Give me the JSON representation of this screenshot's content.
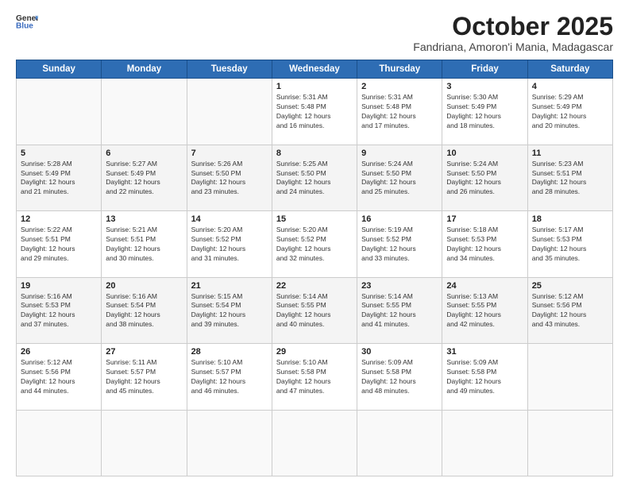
{
  "logo": {
    "general": "General",
    "blue": "Blue"
  },
  "header": {
    "month": "October 2025",
    "location": "Fandriana, Amoron'i Mania, Madagascar"
  },
  "weekdays": [
    "Sunday",
    "Monday",
    "Tuesday",
    "Wednesday",
    "Thursday",
    "Friday",
    "Saturday"
  ],
  "days": [
    {
      "date": "",
      "info": ""
    },
    {
      "date": "",
      "info": ""
    },
    {
      "date": "",
      "info": ""
    },
    {
      "date": "1",
      "info": "Sunrise: 5:31 AM\nSunset: 5:48 PM\nDaylight: 12 hours\nand 16 minutes."
    },
    {
      "date": "2",
      "info": "Sunrise: 5:31 AM\nSunset: 5:48 PM\nDaylight: 12 hours\nand 17 minutes."
    },
    {
      "date": "3",
      "info": "Sunrise: 5:30 AM\nSunset: 5:49 PM\nDaylight: 12 hours\nand 18 minutes."
    },
    {
      "date": "4",
      "info": "Sunrise: 5:29 AM\nSunset: 5:49 PM\nDaylight: 12 hours\nand 20 minutes."
    },
    {
      "date": "5",
      "info": "Sunrise: 5:28 AM\nSunset: 5:49 PM\nDaylight: 12 hours\nand 21 minutes."
    },
    {
      "date": "6",
      "info": "Sunrise: 5:27 AM\nSunset: 5:49 PM\nDaylight: 12 hours\nand 22 minutes."
    },
    {
      "date": "7",
      "info": "Sunrise: 5:26 AM\nSunset: 5:50 PM\nDaylight: 12 hours\nand 23 minutes."
    },
    {
      "date": "8",
      "info": "Sunrise: 5:25 AM\nSunset: 5:50 PM\nDaylight: 12 hours\nand 24 minutes."
    },
    {
      "date": "9",
      "info": "Sunrise: 5:24 AM\nSunset: 5:50 PM\nDaylight: 12 hours\nand 25 minutes."
    },
    {
      "date": "10",
      "info": "Sunrise: 5:24 AM\nSunset: 5:50 PM\nDaylight: 12 hours\nand 26 minutes."
    },
    {
      "date": "11",
      "info": "Sunrise: 5:23 AM\nSunset: 5:51 PM\nDaylight: 12 hours\nand 28 minutes."
    },
    {
      "date": "12",
      "info": "Sunrise: 5:22 AM\nSunset: 5:51 PM\nDaylight: 12 hours\nand 29 minutes."
    },
    {
      "date": "13",
      "info": "Sunrise: 5:21 AM\nSunset: 5:51 PM\nDaylight: 12 hours\nand 30 minutes."
    },
    {
      "date": "14",
      "info": "Sunrise: 5:20 AM\nSunset: 5:52 PM\nDaylight: 12 hours\nand 31 minutes."
    },
    {
      "date": "15",
      "info": "Sunrise: 5:20 AM\nSunset: 5:52 PM\nDaylight: 12 hours\nand 32 minutes."
    },
    {
      "date": "16",
      "info": "Sunrise: 5:19 AM\nSunset: 5:52 PM\nDaylight: 12 hours\nand 33 minutes."
    },
    {
      "date": "17",
      "info": "Sunrise: 5:18 AM\nSunset: 5:53 PM\nDaylight: 12 hours\nand 34 minutes."
    },
    {
      "date": "18",
      "info": "Sunrise: 5:17 AM\nSunset: 5:53 PM\nDaylight: 12 hours\nand 35 minutes."
    },
    {
      "date": "19",
      "info": "Sunrise: 5:16 AM\nSunset: 5:53 PM\nDaylight: 12 hours\nand 37 minutes."
    },
    {
      "date": "20",
      "info": "Sunrise: 5:16 AM\nSunset: 5:54 PM\nDaylight: 12 hours\nand 38 minutes."
    },
    {
      "date": "21",
      "info": "Sunrise: 5:15 AM\nSunset: 5:54 PM\nDaylight: 12 hours\nand 39 minutes."
    },
    {
      "date": "22",
      "info": "Sunrise: 5:14 AM\nSunset: 5:55 PM\nDaylight: 12 hours\nand 40 minutes."
    },
    {
      "date": "23",
      "info": "Sunrise: 5:14 AM\nSunset: 5:55 PM\nDaylight: 12 hours\nand 41 minutes."
    },
    {
      "date": "24",
      "info": "Sunrise: 5:13 AM\nSunset: 5:55 PM\nDaylight: 12 hours\nand 42 minutes."
    },
    {
      "date": "25",
      "info": "Sunrise: 5:12 AM\nSunset: 5:56 PM\nDaylight: 12 hours\nand 43 minutes."
    },
    {
      "date": "26",
      "info": "Sunrise: 5:12 AM\nSunset: 5:56 PM\nDaylight: 12 hours\nand 44 minutes."
    },
    {
      "date": "27",
      "info": "Sunrise: 5:11 AM\nSunset: 5:57 PM\nDaylight: 12 hours\nand 45 minutes."
    },
    {
      "date": "28",
      "info": "Sunrise: 5:10 AM\nSunset: 5:57 PM\nDaylight: 12 hours\nand 46 minutes."
    },
    {
      "date": "29",
      "info": "Sunrise: 5:10 AM\nSunset: 5:58 PM\nDaylight: 12 hours\nand 47 minutes."
    },
    {
      "date": "30",
      "info": "Sunrise: 5:09 AM\nSunset: 5:58 PM\nDaylight: 12 hours\nand 48 minutes."
    },
    {
      "date": "31",
      "info": "Sunrise: 5:09 AM\nSunset: 5:58 PM\nDaylight: 12 hours\nand 49 minutes."
    },
    {
      "date": "",
      "info": ""
    },
    {
      "date": "",
      "info": ""
    }
  ]
}
